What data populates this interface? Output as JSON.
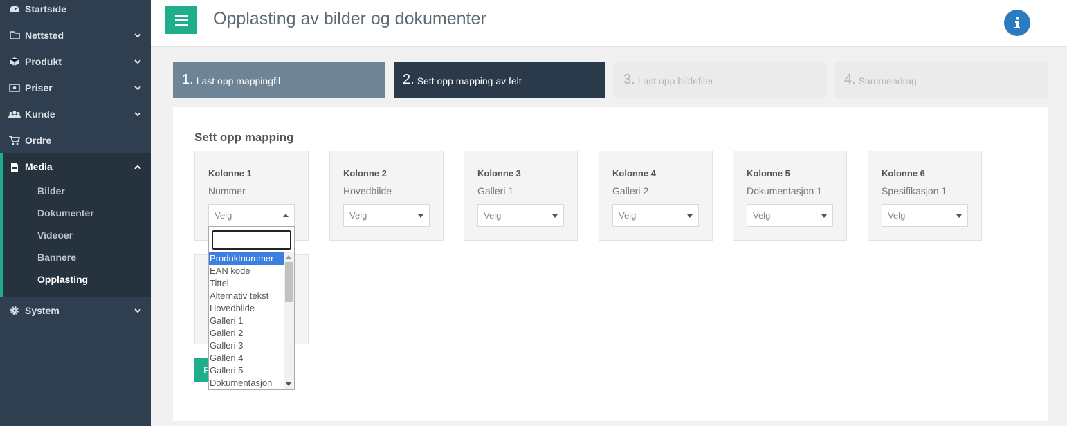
{
  "header": {
    "title": "Opplasting av bilder og dokumenter"
  },
  "sidebar": {
    "items": [
      {
        "label": "Startside",
        "icon": "dashboard-icon"
      },
      {
        "label": "Nettsted",
        "icon": "folder-icon"
      },
      {
        "label": "Produkt",
        "icon": "cube-icon"
      },
      {
        "label": "Priser",
        "icon": "money-icon"
      },
      {
        "label": "Kunde",
        "icon": "users-icon"
      },
      {
        "label": "Ordre",
        "icon": "cart-icon"
      },
      {
        "label": "Media",
        "icon": "file-image-icon"
      },
      {
        "label": "System",
        "icon": "gear-icon"
      }
    ],
    "media_subitems": [
      {
        "label": "Bilder"
      },
      {
        "label": "Dokumenter"
      },
      {
        "label": "Videoer"
      },
      {
        "label": "Bannere"
      },
      {
        "label": "Opplasting"
      }
    ]
  },
  "steps": [
    {
      "num": "1.",
      "label": "Last opp mappingfil"
    },
    {
      "num": "2.",
      "label": "Sett opp mapping av felt"
    },
    {
      "num": "3.",
      "label": "Last opp bildefiler"
    },
    {
      "num": "4.",
      "label": "Sammendrag"
    }
  ],
  "main": {
    "section_title": "Sett opp mapping",
    "columns": [
      {
        "header": "Kolonne 1",
        "field": "Nummer",
        "select": "Velg"
      },
      {
        "header": "Kolonne 2",
        "field": "Hovedbilde",
        "select": "Velg"
      },
      {
        "header": "Kolonne 3",
        "field": "Galleri 1",
        "select": "Velg"
      },
      {
        "header": "Kolonne 4",
        "field": "Galleri 2",
        "select": "Velg"
      },
      {
        "header": "Kolonne 5",
        "field": "Dokumentasjon 1",
        "select": "Velg"
      },
      {
        "header": "Kolonne 6",
        "field": "Spesifikasjon 1",
        "select": "Velg"
      }
    ],
    "button_label": "F"
  },
  "dropdown": {
    "options": [
      "Produktnummer",
      "EAN kode",
      "Tittel",
      "Alternativ tekst",
      "Hovedbilde",
      "Galleri 1",
      "Galleri 2",
      "Galleri 3",
      "Galleri 4",
      "Galleri 5",
      "Dokumentasjon"
    ],
    "highlighted": "Produktnummer"
  },
  "colors": {
    "accent": "#1fae8b",
    "sidebar": "#2f3f4f",
    "step_active": "#2a3a4a",
    "highlight": "#3d7fe0"
  }
}
